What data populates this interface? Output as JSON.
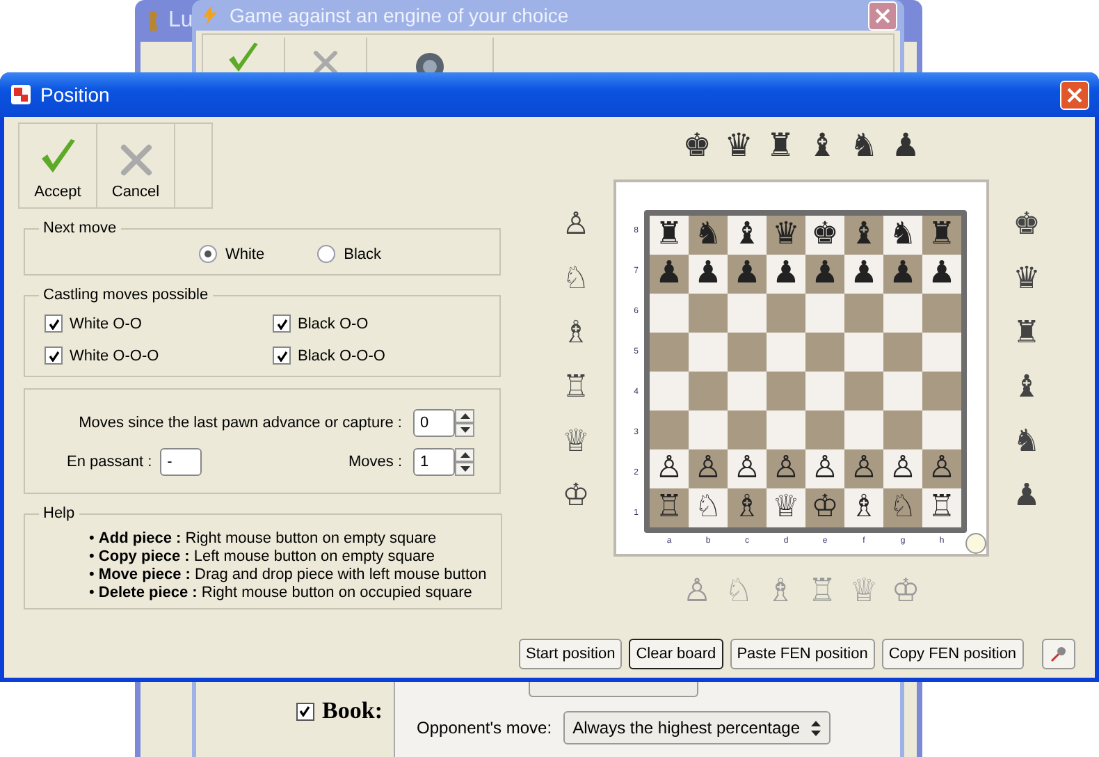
{
  "back_window": {
    "title": "Lu"
  },
  "engine_window": {
    "title": "Game against an engine of your choice",
    "book": {
      "label": "Book:",
      "checked": true
    },
    "opponents_move": {
      "label": "Opponent's move:",
      "value": "Always the highest percentage"
    }
  },
  "dialog": {
    "title": "Position",
    "toolbar": [
      {
        "kind": "accept",
        "label": "Accept"
      },
      {
        "kind": "cancel",
        "label": "Cancel"
      }
    ],
    "next_move": {
      "title": "Next move",
      "options": [
        {
          "label": "White",
          "selected": true
        },
        {
          "label": "Black",
          "selected": false
        }
      ]
    },
    "castling": {
      "title": "Castling moves possible",
      "options": [
        {
          "label": "White O-O",
          "checked": true
        },
        {
          "label": "Black O-O",
          "checked": true
        },
        {
          "label": "White O-O-O",
          "checked": true
        },
        {
          "label": "Black O-O-O",
          "checked": true
        }
      ]
    },
    "counters": {
      "halfmove": {
        "label": "Moves since the last pawn advance or capture :",
        "value": "0"
      },
      "en_passant": {
        "label": "En passant :",
        "value": "-"
      },
      "moves": {
        "label": "Moves :",
        "value": "1"
      }
    },
    "help": {
      "title": "Help",
      "items": [
        "• **Add piece :** Right mouse button on empty square",
        "• **Copy piece :** Left mouse button on empty square",
        "• **Move piece :** Drag and drop piece with left mouse button",
        "• **Delete piece :** Right mouse button on occupied square"
      ]
    },
    "palette_top": [
      "♚",
      "♛",
      "♜",
      "♝",
      "♞",
      "♟"
    ],
    "palette_left": [
      "♙",
      "♘",
      "♗",
      "♖",
      "♕",
      "♔"
    ],
    "palette_right": [
      "♚",
      "♛",
      "♜",
      "♝",
      "♞",
      "♟"
    ],
    "palette_bottom": [
      "♙",
      "♘",
      "♗",
      "♖",
      "♕",
      "♔"
    ],
    "board": {
      "ranks": [
        {
          "label": "8",
          "squares": [
            "♜",
            "♞",
            "♝",
            "♛",
            "♚",
            "♝",
            "♞",
            "♜"
          ]
        },
        {
          "label": "7",
          "squares": [
            "♟",
            "♟",
            "♟",
            "♟",
            "♟",
            "♟",
            "♟",
            "♟"
          ]
        },
        {
          "label": "6"
        },
        {
          "label": "5"
        },
        {
          "label": "4"
        },
        {
          "label": "3"
        },
        {
          "label": "2",
          "squares": [
            "♙",
            "♙",
            "♙",
            "♙",
            "♙",
            "♙",
            "♙",
            "♙"
          ]
        },
        {
          "label": "1",
          "squares": [
            "♖",
            "♘",
            "♗",
            "♕",
            "♔",
            "♗",
            "♘",
            "♖"
          ]
        }
      ],
      "files": [
        "a",
        "b",
        "c",
        "d",
        "e",
        "f",
        "g",
        "h"
      ]
    },
    "buttons": [
      {
        "kind": "text",
        "label": "Start position",
        "focused": false
      },
      {
        "kind": "text",
        "label": "Clear board",
        "focused": true
      },
      {
        "kind": "text",
        "label": "Paste FEN position",
        "focused": false
      },
      {
        "kind": "text",
        "label": "Copy FEN position",
        "focused": false
      },
      {
        "kind": "pin",
        "focused": false
      }
    ]
  }
}
